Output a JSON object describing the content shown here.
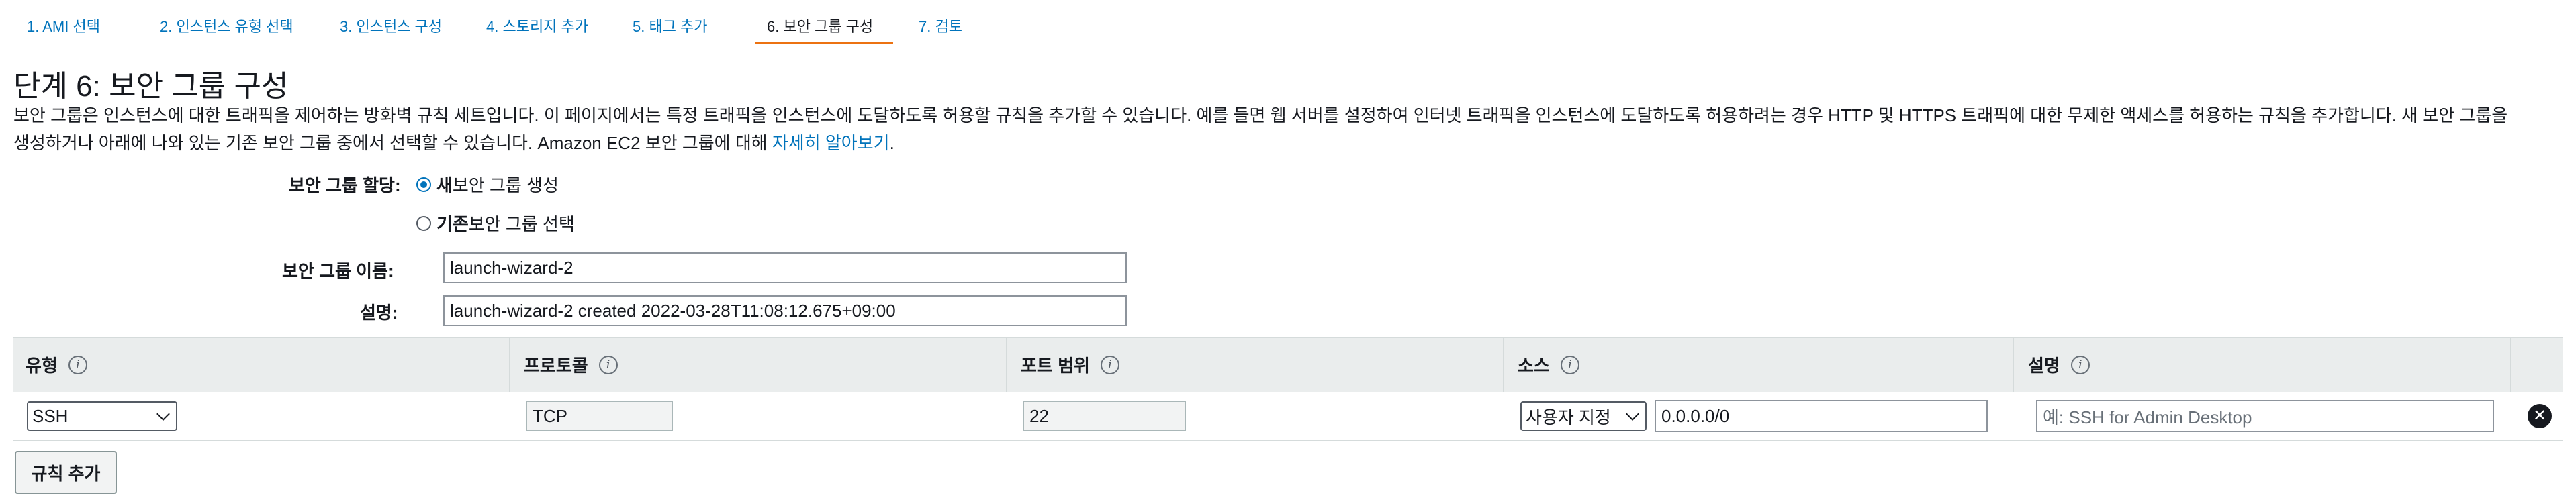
{
  "tabs": [
    {
      "label": "1. AMI 선택"
    },
    {
      "label": "2. 인스턴스 유형 선택"
    },
    {
      "label": "3. 인스턴스 구성"
    },
    {
      "label": "4. 스토리지 추가"
    },
    {
      "label": "5. 태그 추가"
    },
    {
      "label": "6. 보안 그룹 구성",
      "active": true
    },
    {
      "label": "7. 검토"
    }
  ],
  "page": {
    "title": "단계 6: 보안 그룹 구성",
    "description_line1": "보안 그룹은 인스턴스에 대한 트래픽을 제어하는 방화벽 규칙 세트입니다. 이 페이지에서는 특정 트래픽을 인스턴스에 도달하도록 허용할 규칙을 추가할 수 있습니다. 예를 들면 웹 서버를 설정하여 인터넷 트래픽을 인스턴스에 도달하도록 허용하려는 경우 HTTP 및 HTTPS 트래픽에 대한 무제한 액세스를 허용하는 규칙을 추가합니다. 새 보안 그룹을",
    "description_line2": "생성하거나 아래에 나와 있는 기존 보안 그룹 중에서 선택할 수 있습니다. Amazon EC2 보안 그룹에 대해 ",
    "learn_more": "자세히 알아보기",
    "learn_more_suffix": "."
  },
  "assign": {
    "label": "보안 그룹 할당:",
    "new_bold": "새",
    "new_rest": " 보안 그룹 생성",
    "existing_bold": "기존",
    "existing_rest": " 보안 그룹 선택",
    "selected": "new"
  },
  "form": {
    "name_label": "보안 그룹 이름:",
    "name_value": "launch-wizard-2",
    "desc_label": "설명:",
    "desc_value": "launch-wizard-2 created 2022-03-28T11:08:12.675+09:00"
  },
  "table": {
    "headers": {
      "type": "유형",
      "protocol": "프로토콜",
      "port": "포트 범위",
      "source": "소스",
      "description": "설명"
    },
    "rows": [
      {
        "type": "SSH",
        "protocol": "TCP",
        "port": "22",
        "source_mode": "사용자 지정",
        "source_value": "0.0.0.0/0",
        "description_placeholder": "예: SSH for Admin Desktop"
      }
    ]
  },
  "actions": {
    "add_rule": "규칙 추가"
  },
  "icons": {
    "info": "info-icon",
    "remove": "remove-circle-icon",
    "dropdown": "chevron-down-icon"
  },
  "colors": {
    "link": "#0073bb",
    "active_tab_underline": "#ec7211",
    "table_header_bg": "#eaeded"
  }
}
